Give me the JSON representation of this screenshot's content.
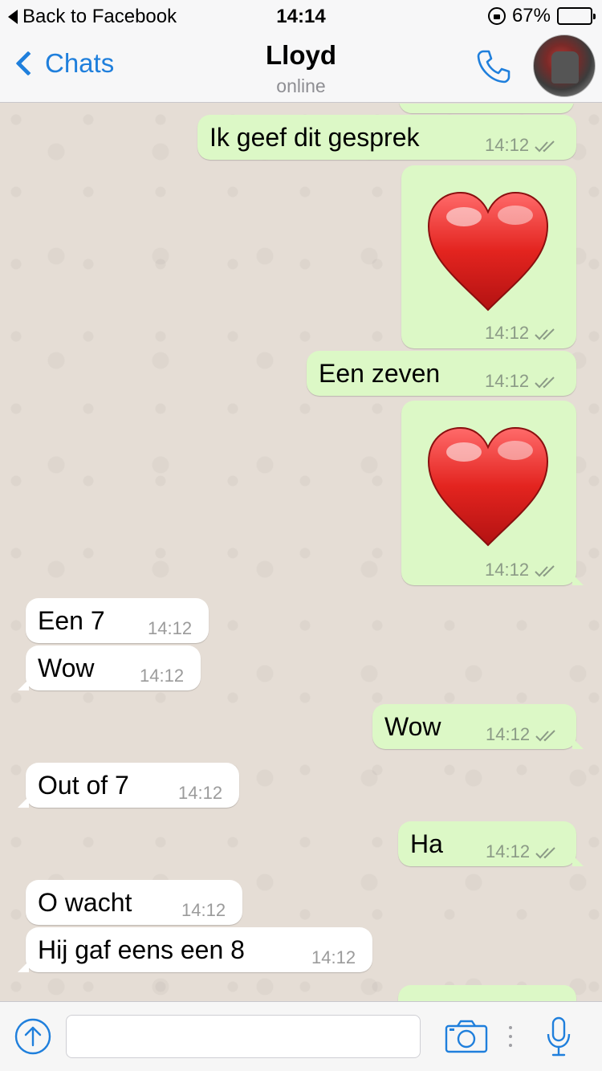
{
  "status_bar": {
    "back_label": "Back to Facebook",
    "time": "14:14",
    "battery": "67%",
    "battery_level": 0.67
  },
  "nav": {
    "back_label": "Chats",
    "contact_name": "Lloyd",
    "contact_status": "online"
  },
  "messages": [
    {
      "direction": "out",
      "type": "text",
      "text": "Ik geef dit gesprek",
      "time": "14:12",
      "ticks": true
    },
    {
      "direction": "out",
      "type": "emoji",
      "emoji": "heart",
      "time": "14:12",
      "ticks": true
    },
    {
      "direction": "out",
      "type": "text",
      "text": "Een zeven",
      "time": "14:12",
      "ticks": true
    },
    {
      "direction": "out",
      "type": "emoji",
      "emoji": "heart",
      "time": "14:12",
      "ticks": true
    },
    {
      "direction": "in",
      "type": "text",
      "text": "Een 7",
      "time": "14:12"
    },
    {
      "direction": "in",
      "type": "text",
      "text": "Wow",
      "time": "14:12"
    },
    {
      "direction": "out",
      "type": "text",
      "text": "Wow",
      "time": "14:12",
      "ticks": true
    },
    {
      "direction": "in",
      "type": "text",
      "text": "Out of 7",
      "time": "14:12"
    },
    {
      "direction": "out",
      "type": "text",
      "text": "Ha",
      "time": "14:12",
      "ticks": true
    },
    {
      "direction": "in",
      "type": "text",
      "text": "O wacht",
      "time": "14:12"
    },
    {
      "direction": "in",
      "type": "text",
      "text": "Hij gaf eens een 8",
      "time": "14:12"
    }
  ],
  "input": {
    "value": "",
    "placeholder": ""
  },
  "icons": {
    "status_lock": "rotation-lock-icon",
    "battery": "battery-icon",
    "back": "chevron-left-icon",
    "call": "phone-icon",
    "upload": "upload-arrow-icon",
    "camera": "camera-icon",
    "mic": "microphone-icon"
  },
  "colors": {
    "accent": "#1f7fdc",
    "outgoing_bubble": "#dcf8c6",
    "incoming_bubble": "#ffffff",
    "chat_background": "#e5ddd5",
    "battery_fill": "#ffcc00",
    "heart": "#d81e1e"
  }
}
